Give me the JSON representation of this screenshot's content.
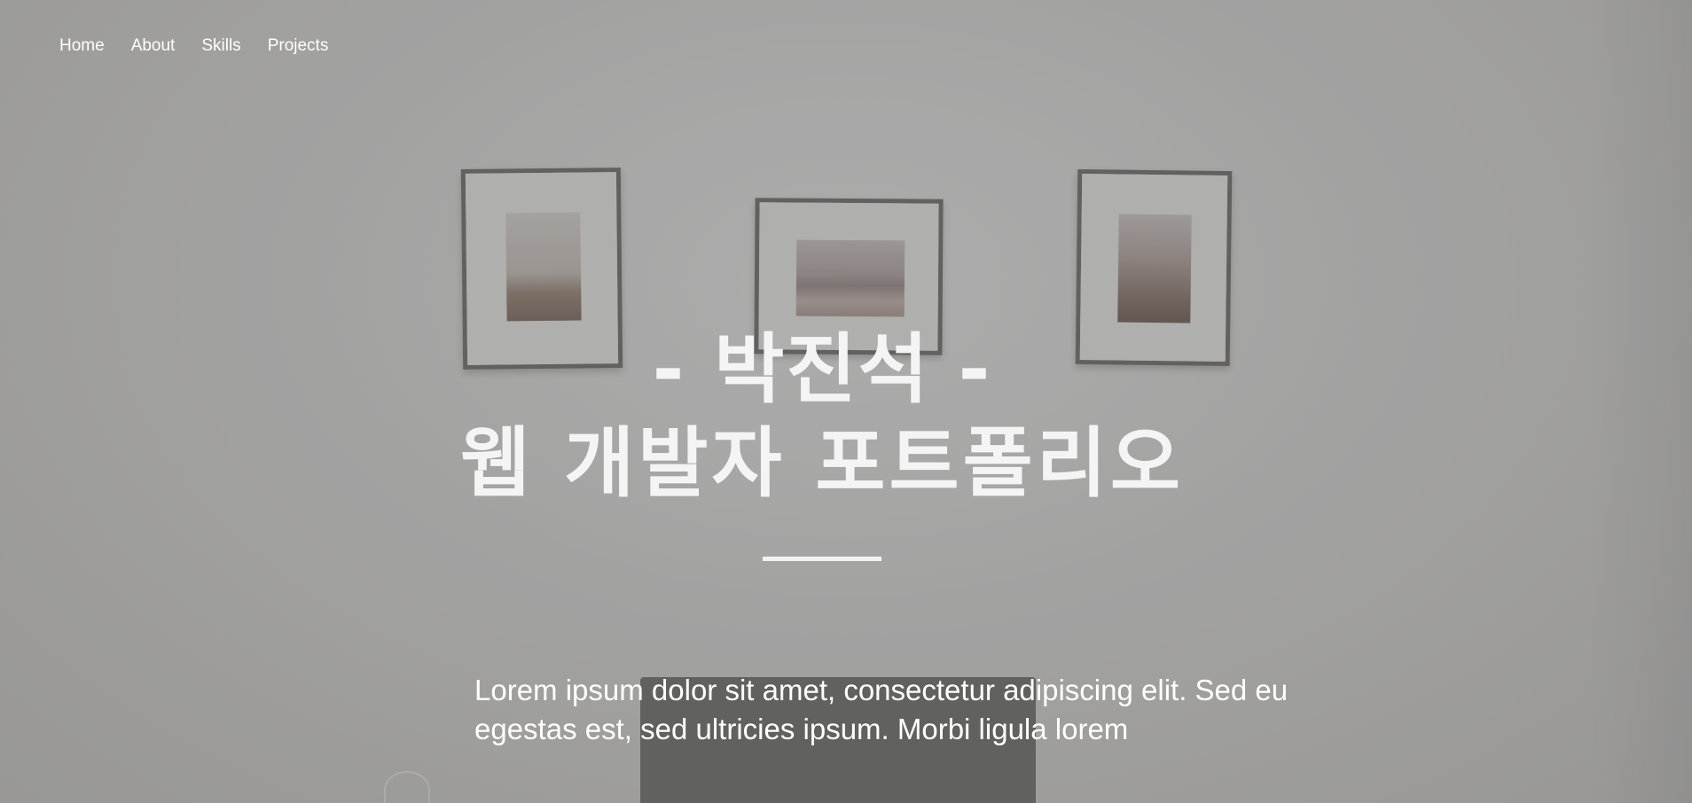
{
  "nav": {
    "items": [
      {
        "label": "Home"
      },
      {
        "label": "About"
      },
      {
        "label": "Skills"
      },
      {
        "label": "Projects"
      }
    ]
  },
  "hero": {
    "name": "- 박진석 -",
    "title": "웹 개발자 포트폴리오",
    "intro": "Lorem ipsum dolor sit amet, consectetur adipiscing elit. Sed eu egestas est, sed ultricies ipsum. Morbi ligula lorem"
  },
  "colors": {
    "text": "#ffffff",
    "background": "#a3a2a0"
  }
}
